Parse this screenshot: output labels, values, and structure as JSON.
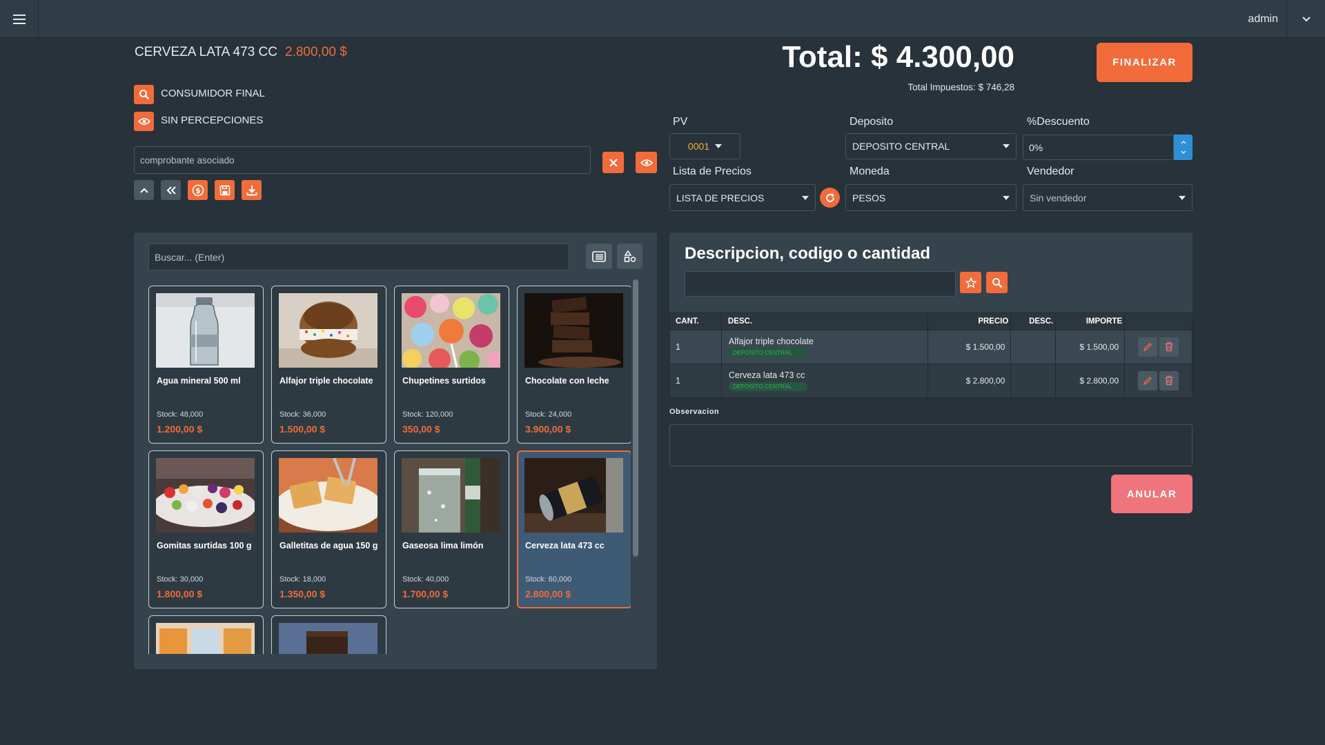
{
  "topbar": {
    "menu_icon": "hamburger-icon",
    "user": "admin",
    "user_menu_icon": "chevron-down-icon"
  },
  "current_item": {
    "name": "CERVEZA LATA 473 CC",
    "price": "2.800,00 $"
  },
  "customer": {
    "label": "CONSUMIDOR FINAL"
  },
  "perceptions": {
    "label": "SIN PERCEPCIONES"
  },
  "associated_voucher": {
    "placeholder": "comprobante asociado"
  },
  "totals": {
    "total": "Total: $ 4.300,00",
    "taxes": "Total Impuestos: $ 746,28"
  },
  "finalize_label": "FINALIZAR",
  "cancel_label": "ANULAR",
  "form": {
    "pv_label": "PV",
    "pv_value": "0001",
    "deposito_label": "Deposito",
    "deposito_value": "DEPOSITO CENTRAL",
    "descuento_label": "%Descuento",
    "descuento_value": "0%",
    "lista_label": "Lista de Precios",
    "lista_value": "LISTA DE PRECIOS",
    "moneda_label": "Moneda",
    "moneda_value": "PESOS",
    "vendedor_label": "Vendedor",
    "vendedor_value": "Sin vendedor"
  },
  "catalog": {
    "search_placeholder": "Buscar... (Enter)",
    "products": [
      {
        "name": "Agua mineral 500 ml",
        "stock": "Stock: 48,000",
        "price": "1.200,00 $",
        "image": "water-bottle"
      },
      {
        "name": "Alfajor triple chocolate",
        "stock": "Stock: 36,000",
        "price": "1.500,00 $",
        "image": "cookie-sandwich"
      },
      {
        "name": "Chupetines surtidos",
        "stock": "Stock: 120,000",
        "price": "350,00 $",
        "image": "lollipops"
      },
      {
        "name": "Chocolate con leche",
        "stock": "Stock: 24,000",
        "price": "3.900,00 $",
        "image": "chocolate-bars"
      },
      {
        "name": "Gomitas surtidas 100 g",
        "stock": "Stock: 30,000",
        "price": "1.800,00 $",
        "image": "gummies"
      },
      {
        "name": "Galletitas de agua 150 g",
        "stock": "Stock: 18,000",
        "price": "1.350,00 $",
        "image": "crackers"
      },
      {
        "name": "Gaseosa lima limón",
        "stock": "Stock: 40,000",
        "price": "1.700,00 $",
        "image": "soda-glass"
      },
      {
        "name": "Cerveza lata 473 cc",
        "stock": "Stock: 60,000",
        "price": "2.800,00 $",
        "image": "beer-can"
      }
    ]
  },
  "order": {
    "title": "Descripcion, codigo o cantidad",
    "columns": [
      "CANT.",
      "DESC.",
      "PRECIO",
      "DESC.",
      "IMPORTE"
    ],
    "rows": [
      {
        "qty": "1",
        "desc": "Alfajor triple chocolate",
        "tag": "DEPOSITO CENTRAL",
        "price": "$ 1.500,00",
        "discount": "",
        "amount": "$ 1.500,00"
      },
      {
        "qty": "1",
        "desc": "Cerveza lata 473 cc",
        "tag": "DEPOSITO CENTRAL",
        "price": "$ 2.800,00",
        "discount": "",
        "amount": "$ 2.800,00"
      }
    ],
    "observacion_label": "Observacion"
  },
  "colors": {
    "accent": "#f26b3a",
    "background": "#27323a",
    "panel": "#35434c",
    "cancel": "#f0747c",
    "spinner": "#2e8fd6"
  }
}
